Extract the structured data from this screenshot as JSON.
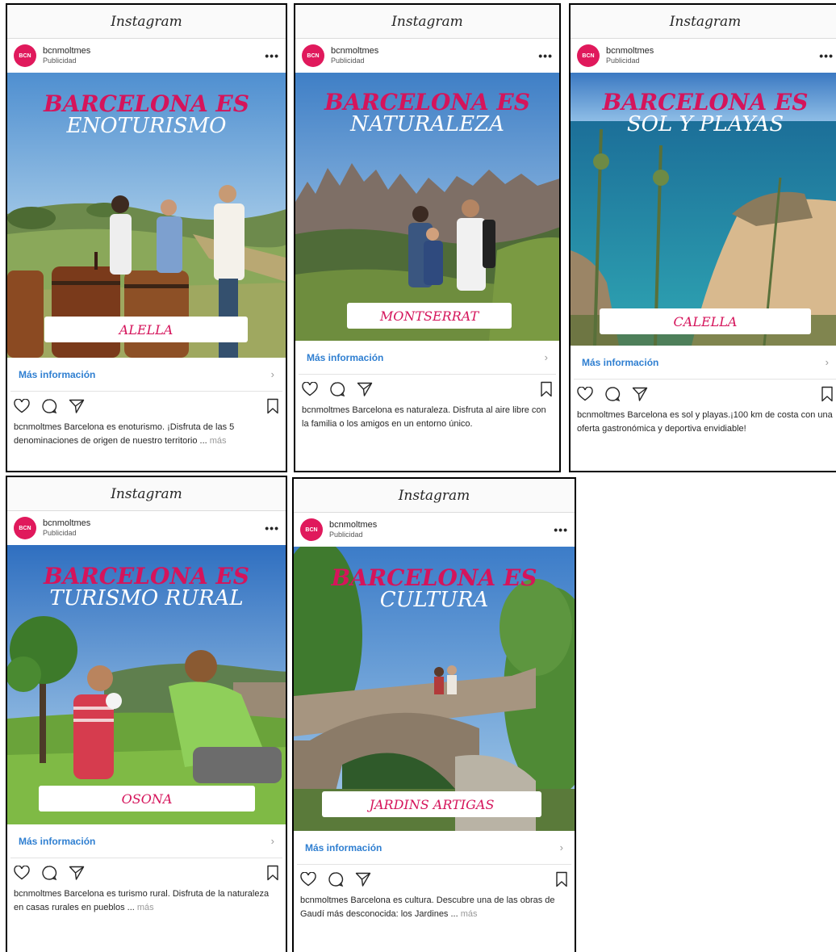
{
  "theme": {
    "brand": "#d5145b",
    "link": "#2f7fd1",
    "avatar_bg": "#e0195c"
  },
  "icons": {
    "like": "heart-icon",
    "comment": "comment-icon",
    "share": "send-icon",
    "save": "bookmark-icon",
    "menu": "more-dots-icon",
    "cta": "chevron-right-icon"
  },
  "posts": [
    {
      "app_title": "Instagram",
      "avatar_text": "BCN",
      "account": "bcnmoltmes",
      "sponsored": "Publicidad",
      "menu": "•••",
      "headline_1": "BARCELONA ES",
      "headline_2": "ENOTURISMO",
      "place": "ALELLA",
      "cta": "Más información",
      "chevron": "›",
      "caption_user": "bcnmoltmes",
      "caption": "Barcelona es enoturismo. ¡Disfruta de las 5 denominaciones de origen de nuestro territorio ...",
      "more": "más"
    },
    {
      "app_title": "Instagram",
      "avatar_text": "BCN",
      "account": "bcnmoltmes",
      "sponsored": "Publicidad",
      "menu": "•••",
      "headline_1": "BARCELONA ES",
      "headline_2": "NATURALEZA",
      "place": "MONTSERRAT",
      "cta": "Más información",
      "chevron": "›",
      "caption_user": "bcnmoltmes",
      "caption": "Barcelona es naturaleza. Disfruta al aire libre con la familia o los amigos en un entorno único.",
      "more": ""
    },
    {
      "app_title": "Instagram",
      "avatar_text": "BCN",
      "account": "bcnmoltmes",
      "sponsored": "Publicidad",
      "menu": "•••",
      "headline_1": "BARCELONA ES",
      "headline_2": "SOL Y PLAYAS",
      "place": "CALELLA",
      "cta": "Más información",
      "chevron": "›",
      "caption_user": "bcnmoltmes",
      "caption": "Barcelona es sol y playas.¡100 km de costa con una oferta gastronómica y deportiva envidiable!",
      "more": ""
    },
    {
      "app_title": "Instagram",
      "avatar_text": "BCN",
      "account": "bcnmoltmes",
      "sponsored": "Publicidad",
      "menu": "•••",
      "headline_1": "BARCELONA ES",
      "headline_2": "TURISMO RURAL",
      "place": "OSONA",
      "cta": "Más información",
      "chevron": "›",
      "caption_user": "bcnmoltmes",
      "caption": "Barcelona es turismo rural. Disfruta de la naturaleza en casas rurales en pueblos ...",
      "more": "más"
    },
    {
      "app_title": "Instagram",
      "avatar_text": "BCN",
      "account": "bcnmoltmes",
      "sponsored": "Publicidad",
      "menu": "•••",
      "headline_1": "BARCELONA ES",
      "headline_2": "CULTURA",
      "place": "JARDINS ARTIGAS",
      "cta": "Más información",
      "chevron": "›",
      "caption_user": "bcnmoltmes",
      "caption": "Barcelona es cultura. Descubre una de las obras de Gaudí más desconocida: los Jardines ...",
      "more": "más"
    }
  ]
}
